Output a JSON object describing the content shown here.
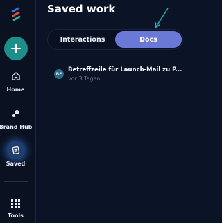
{
  "header": {
    "title": "Saved work"
  },
  "rail": {
    "items": [
      {
        "label": "Home",
        "icon": "home-icon"
      },
      {
        "label": "Brand Hub",
        "icon": "brand-hub-icon"
      },
      {
        "label": "Saved",
        "icon": "saved-icon",
        "active": true
      },
      {
        "label": "Tools",
        "icon": "grid-icon"
      }
    ],
    "new_button_icon": "plus-icon"
  },
  "tabs": [
    {
      "label": "Interactions",
      "active": false
    },
    {
      "label": "Docs",
      "active": true
    }
  ],
  "docs": [
    {
      "avatar": "BF",
      "title": "Betreffzeile für Launch-Mail zu P...",
      "time": "vor 3 Tagen"
    }
  ],
  "colors": {
    "background": "#0b1326",
    "accent": "#6a79d6",
    "new_button": "#1e8e8a",
    "annotation_arrow": "#27b5c9"
  }
}
